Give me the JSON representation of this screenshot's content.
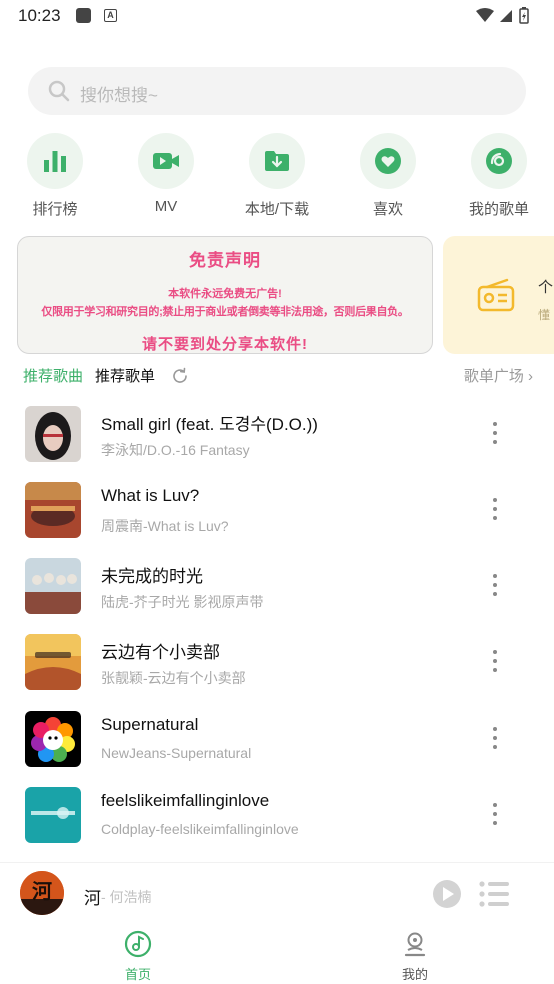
{
  "status": {
    "time": "10:23",
    "badge": "A"
  },
  "search": {
    "placeholder": "搜你想搜~"
  },
  "categories": [
    {
      "label": "排行榜",
      "icon": "bar-chart-icon"
    },
    {
      "label": "MV",
      "icon": "video-camera-icon"
    },
    {
      "label": "本地/下载",
      "icon": "download-folder-icon"
    },
    {
      "label": "喜欢",
      "icon": "heart-icon"
    },
    {
      "label": "我的歌单",
      "icon": "disc-icon"
    }
  ],
  "banner": {
    "title": "免责声明",
    "line1": "本软件永远免费无广告!",
    "line2": "仅限用于学习和研究目的;禁止用于商业或者倒卖等非法用途，否则后果自负。",
    "line3": "请不要到处分享本软件!",
    "text_color": "#ea4d84"
  },
  "banner2": {
    "title": "个",
    "subtitle": "懂",
    "icon": "radio-icon"
  },
  "tabs": {
    "songs": "推荐歌曲",
    "playlists": "推荐歌单",
    "plaza": "歌单广场 ›"
  },
  "songs": [
    {
      "title": "Small girl (feat. 도경수(D.O.))",
      "subtitle": "李泳知/D.O.-16 Fantasy"
    },
    {
      "title": "What is Luv?",
      "subtitle": "周震南-What is Luv?"
    },
    {
      "title": "未完成的时光",
      "subtitle": "陆虎-芥子时光 影视原声带"
    },
    {
      "title": "云边有个小卖部",
      "subtitle": "张靓颖-云边有个小卖部"
    },
    {
      "title": "Supernatural",
      "subtitle": "NewJeans-Supernatural"
    },
    {
      "title": "feelslikeimfallinginlove",
      "subtitle": "Coldplay-feelslikeimfallinginlove"
    }
  ],
  "player": {
    "title": "河",
    "artist": "- 何浩楠",
    "cover_text": "河"
  },
  "nav": {
    "home": "首页",
    "mine": "我的"
  },
  "colors": {
    "accent": "#3db06a",
    "category_bg": "#edf5ee",
    "banner_pink": "#ea4d84",
    "banner2_bg": "#fdf4d8"
  }
}
